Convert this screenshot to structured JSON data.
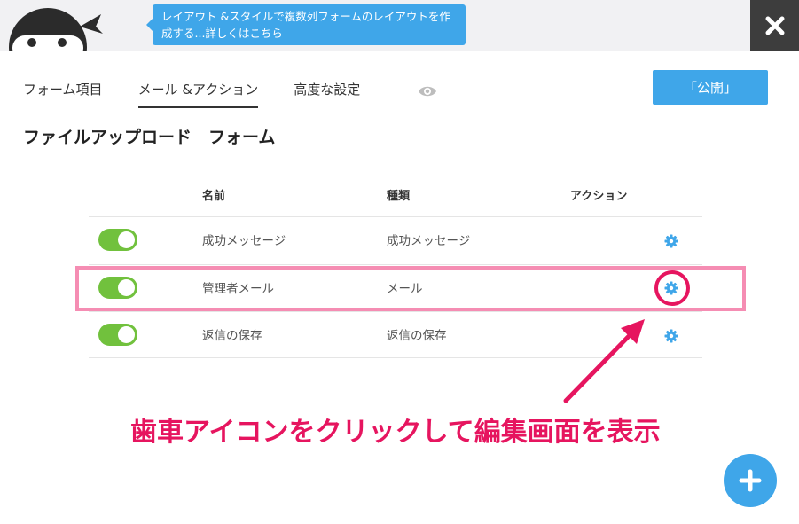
{
  "header": {
    "tooltip_text": "レイアウト &スタイルで複数列フォームのレイアウトを作成する...詳しくはこちら",
    "close_icon": "close-icon",
    "mascot_icon": "ninja-mascot-icon"
  },
  "tabs": [
    {
      "label": "フォーム項目",
      "active": false
    },
    {
      "label": "メール &アクション",
      "active": true
    },
    {
      "label": "高度な設定",
      "active": false
    }
  ],
  "preview_icon": "eye-icon",
  "publish_label": "「公開」",
  "form_title": "ファイルアップロード　フォーム",
  "table": {
    "headers": {
      "name": "名前",
      "type": "種類",
      "action": "アクション"
    },
    "rows": [
      {
        "name": "成功メッセージ",
        "type": "成功メッセージ",
        "enabled": true
      },
      {
        "name": "管理者メール",
        "type": "メール",
        "enabled": true
      },
      {
        "name": "返信の保存",
        "type": "返信の保存",
        "enabled": true
      }
    ]
  },
  "annotation_text": "歯車アイコンをクリックして編集画面を表示",
  "colors": {
    "accent": "#3fa6e9",
    "toggle_on": "#71c13d",
    "annotation": "#e6155f",
    "highlight": "#f58db3"
  },
  "add_icon": "plus-icon"
}
